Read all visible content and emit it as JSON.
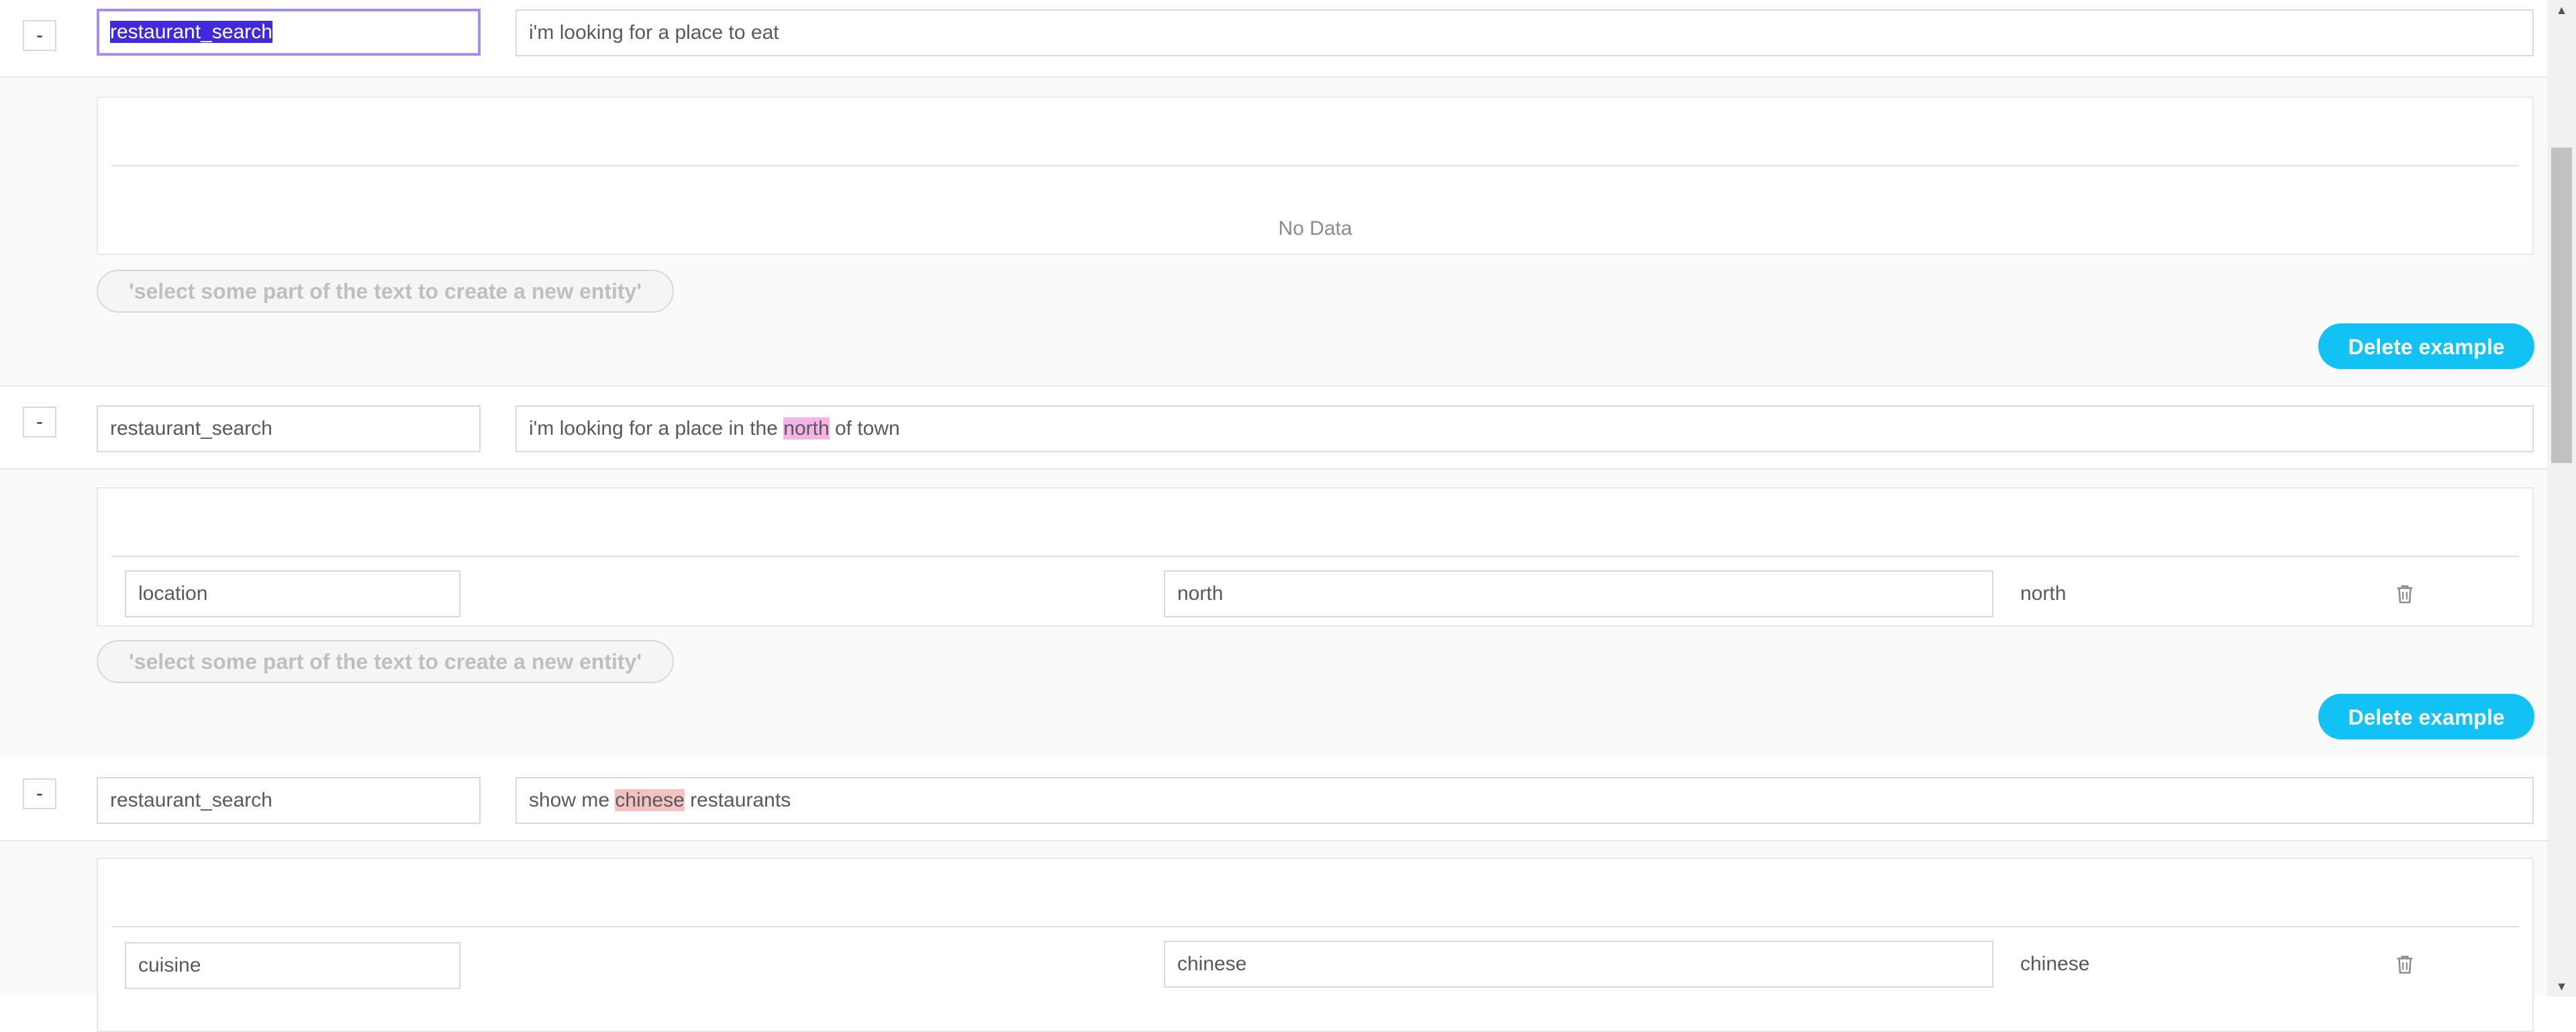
{
  "examples": [
    {
      "collapse_label": "-",
      "intent": "restaurant_search",
      "text_before": "i'm looking for a place to eat",
      "highlight": "",
      "text_after": "",
      "entities_empty_text": "No Data",
      "hint_label": "'select some part of the text to create a new entity'",
      "delete_label": "Delete example"
    },
    {
      "collapse_label": "-",
      "intent": "restaurant_search",
      "text_before": "i'm looking for a place in the ",
      "highlight": "north",
      "text_after": " of town",
      "entity": {
        "name": "location",
        "value_input": "north",
        "value": "north"
      },
      "hint_label": "'select some part of the text to create a new entity'",
      "delete_label": "Delete example"
    },
    {
      "collapse_label": "-",
      "intent": "restaurant_search",
      "text_before": "show me ",
      "highlight": "chinese",
      "text_after": " restaurants",
      "entity": {
        "name": "cuisine",
        "value_input": "chinese",
        "value": "chinese"
      }
    }
  ],
  "colors": {
    "accent_button": "#13c2f5",
    "focus_border": "#a98cf2",
    "selection": "#3f2bdc",
    "highlight_location": "#f3b4e6",
    "highlight_cuisine": "#f4c2c2"
  },
  "icons": {
    "delete_entity": "trash-icon",
    "scroll_up": "triangle-up-icon",
    "scroll_down": "triangle-down-icon"
  }
}
